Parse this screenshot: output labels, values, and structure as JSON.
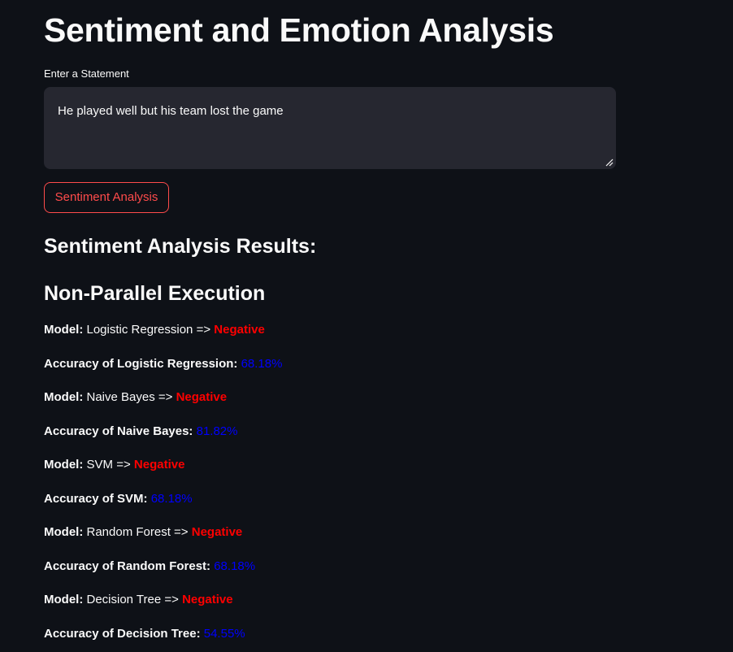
{
  "app": {
    "title": "Sentiment and Emotion Analysis"
  },
  "input": {
    "label": "Enter a Statement",
    "value": "He played well but his team lost the game"
  },
  "button": {
    "label": "Sentiment Analysis"
  },
  "results": {
    "heading": "Sentiment Analysis Results:",
    "subheading": "Non-Parallel Execution",
    "model_prefix": "Model:",
    "arrow": "=>",
    "items": [
      {
        "model": "Logistic Regression",
        "prediction": "Negative",
        "accuracy_label": "Accuracy of Logistic Regression:",
        "accuracy": "68.18%"
      },
      {
        "model": "Naive Bayes",
        "prediction": "Negative",
        "accuracy_label": "Accuracy of Naive Bayes:",
        "accuracy": "81.82%"
      },
      {
        "model": "SVM",
        "prediction": "Negative",
        "accuracy_label": "Accuracy of SVM:",
        "accuracy": "68.18%"
      },
      {
        "model": "Random Forest",
        "prediction": "Negative",
        "accuracy_label": "Accuracy of Random Forest:",
        "accuracy": "68.18%"
      },
      {
        "model": "Decision Tree",
        "prediction": "Negative",
        "accuracy_label": "Accuracy of Decision Tree:",
        "accuracy": "54.55%"
      }
    ]
  },
  "colors": {
    "background": "#0e1117",
    "input_background": "#262730",
    "accent": "#ff4b4b",
    "negative": "#ff0000",
    "accuracy": "#0000ff"
  }
}
